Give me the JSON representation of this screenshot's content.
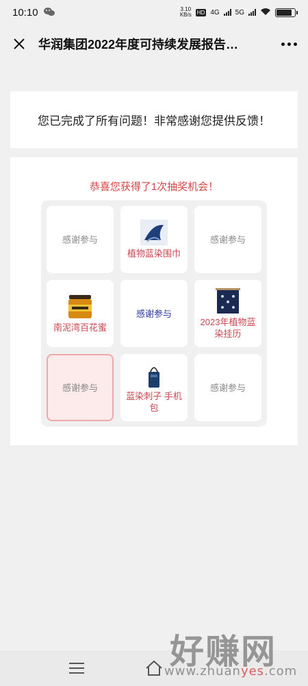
{
  "status_bar": {
    "time": "10:10",
    "net_speed_value": "3.10",
    "net_speed_unit": "KB/s",
    "hd_badge": "HD",
    "network_4g": "4G",
    "network_5g": "5G",
    "battery_level": 0.85
  },
  "nav": {
    "title": "华润集团2022年度可持续发展报告…"
  },
  "completion": {
    "message": "您已完成了所有问题！非常感谢您提供反馈！"
  },
  "lottery": {
    "title": "恭喜您获得了1次抽奖机会！",
    "cells": [
      {
        "label": "感谢参与",
        "type": "thanks",
        "icon": null
      },
      {
        "label": "植物蓝染围巾",
        "type": "prize",
        "icon": "scarf-image"
      },
      {
        "label": "感谢参与",
        "type": "thanks",
        "icon": null
      },
      {
        "label": "南泥湾百花蜜",
        "type": "prize",
        "icon": "honey-jar-image"
      },
      {
        "label": "感谢参与",
        "type": "draw",
        "icon": null
      },
      {
        "label": "2023年植物蓝染挂历",
        "type": "prize",
        "icon": "calendar-image"
      },
      {
        "label": "感谢参与",
        "type": "thanks",
        "icon": null,
        "active": true
      },
      {
        "label": "蓝染刺子 手机包",
        "type": "prize",
        "icon": "phone-bag-image"
      },
      {
        "label": "感谢参与",
        "type": "thanks",
        "icon": null
      }
    ]
  },
  "watermark": {
    "big": "好赚网",
    "url_prefix": "www.zhuan",
    "url_accent": "yes",
    "url_suffix": ".com"
  },
  "colors": {
    "accent_red": "#d64545",
    "prize_text": "#c9474f",
    "draw_text": "#2b39a0",
    "active_bg": "#fdeaea"
  }
}
